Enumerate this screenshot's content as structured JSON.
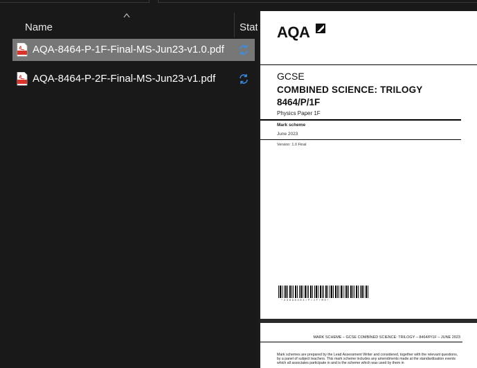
{
  "header": {
    "name_column": "Name",
    "status_column": "Status"
  },
  "files": [
    {
      "name": "AQA-8464-P-1F-Final-MS-Jun23-v1.0.pdf",
      "icon": "pdf-icon",
      "status_icon": "sync-icon",
      "selected": true
    },
    {
      "name": "AQA-8464-P-2F-Final-MS-Jun23-v1.pdf",
      "icon": "pdf-icon",
      "status_icon": "sync-icon",
      "selected": false
    }
  ],
  "preview": {
    "logo": "AQA",
    "level": "GCSE",
    "subject": "COMBINED SCIENCE: TRILOGY",
    "code": "8464/P/1F",
    "paper": "Physics Paper 1F",
    "doc_type": "Mark scheme",
    "date": "June 2023",
    "version": "Version: 1.0 Final",
    "barcode_number": "*236G8464/P/1F/MS*",
    "footer_header": "MARK SCHEME – GCSE COMBINED SCIENCE: TRILOGY – 8464/P/1F – JUNE 2023",
    "footer_text": "Mark schemes are prepared by the Lead Assessment Writer and considered, together with the relevant questions, by a panel of subject teachers. This mark scheme includes any amendments made at the standardisation events which all associates participate in and is the scheme which was used by them in"
  },
  "colors": {
    "background": "#191919",
    "selected_row": "#777777",
    "sync_blue": "#3a8ee6",
    "pdf_red": "#d9342b"
  }
}
